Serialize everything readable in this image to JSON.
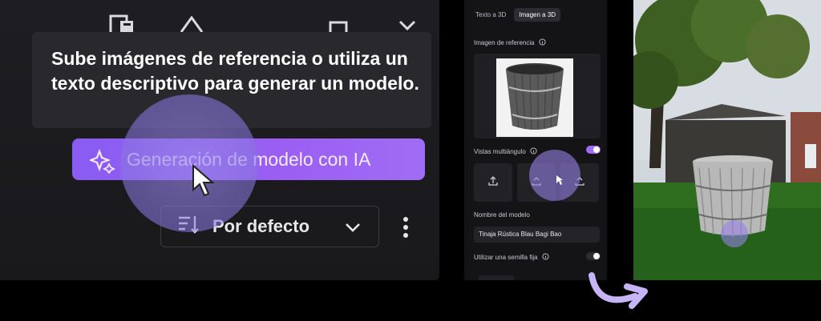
{
  "left_panel": {
    "tooltip_text": "Sube imágenes de referencia o utiliza un texto descriptivo para generar un modelo.",
    "generate_button_label": "Generación de modelo con IA",
    "sort_label": "Por defecto"
  },
  "mid_panel": {
    "tabs": [
      {
        "label": "Texto a 3D",
        "active": false
      },
      {
        "label": "Imagen a 3D",
        "active": true
      }
    ],
    "reference_image_label": "Imagen de referencia",
    "multiview_label": "Vistas multiángulo",
    "multiview_enabled": true,
    "model_name_label": "Nombre del modelo",
    "model_name_value": "Tinaja Rústica Blau Bagi Bao",
    "fixed_seed_label": "Utilizar una semilla fija",
    "fixed_seed_enabled": false
  },
  "colors": {
    "accent": "#9b5ff2",
    "panel_bg": "#1c1c20"
  },
  "icons": [
    "preview-icon",
    "shape-icon",
    "square-icon",
    "chevron-down-icon",
    "sparkle-icon",
    "sort-icon",
    "kebab-icon",
    "info-icon",
    "upload-icon",
    "rotate-icon"
  ]
}
